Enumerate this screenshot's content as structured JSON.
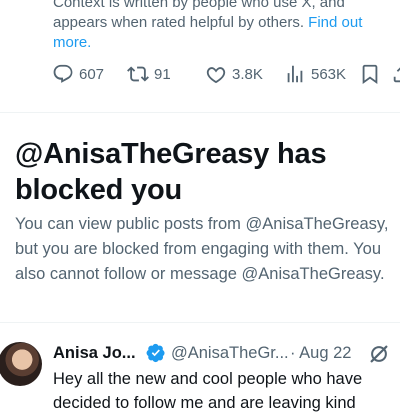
{
  "community_note": {
    "context_text": "Context is written by people who use X, and appears when rated helpful by others.",
    "link_text": "Find out more."
  },
  "actions": {
    "replies": "607",
    "reposts": "91",
    "likes": "3.8K",
    "views": "563K"
  },
  "blocked": {
    "title": "@AnisaTheGreasy has blocked you",
    "description": "You can view public posts from @AnisaTheGreasy, but you are blocked from engaging with them. You also cannot follow or message @AnisaTheGreasy."
  },
  "tweet": {
    "name": "Anisa Jo...",
    "handle": "@AnisaTheGr...",
    "date": "· Aug 22",
    "text": "Hey all the new and cool people who have decided to follow me and are leaving kind"
  },
  "colors": {
    "accent": "#1d9bf0",
    "secondary_text": "#536471",
    "primary_text": "#0f1419"
  }
}
